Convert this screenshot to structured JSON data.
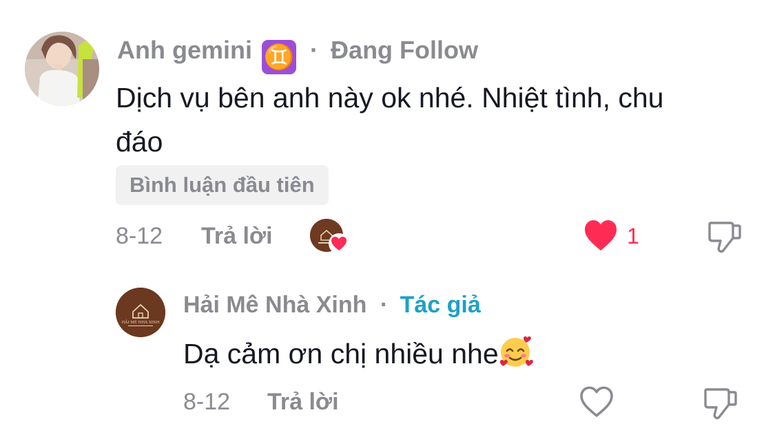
{
  "comment": {
    "username": "Anh gemini",
    "zodiac_badge": "♊",
    "separator": "·",
    "follow_status": "Đang Follow",
    "text_line1": "Dịch vụ bên anh này ok nhé. Nhiệt tình, chu",
    "text_line2": "đáo",
    "chip_label": "Bình luận đầu tiên",
    "date": "8-12",
    "reply_label": "Trả lời",
    "like_count": "1",
    "like_color": "#fe2c55"
  },
  "reply": {
    "username": "Hải Mê Nhà Xinh",
    "separator": "·",
    "author_label": "Tác giả",
    "author_color": "#1ea0c9",
    "text": "Dạ cảm ơn chị nhiều nhe",
    "emoji": "smiling-face-with-hearts",
    "date": "8-12",
    "reply_label": "Trả lời",
    "avatar_brand": "HẢI MÊ NHÀ XINH"
  }
}
